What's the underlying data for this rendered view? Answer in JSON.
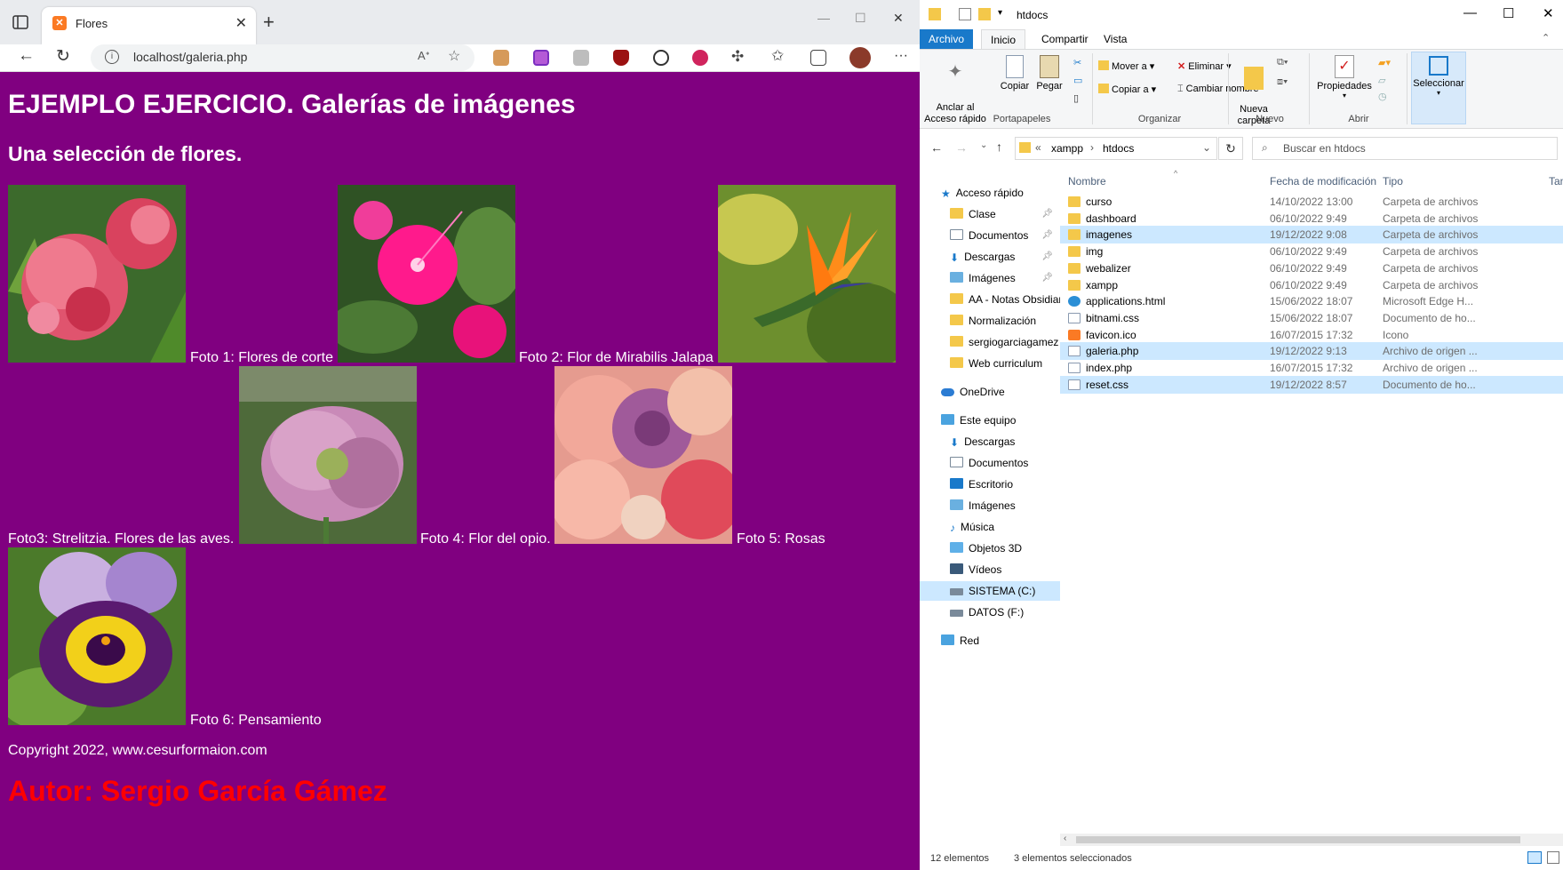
{
  "browser": {
    "tab_title": "Flores",
    "url": "localhost/galeria.php"
  },
  "page": {
    "heading": "EJEMPLO EJERCICIO. Galerías de imágenes",
    "subheading": "Una selección de flores.",
    "captions": [
      "Foto 1: Flores de corte",
      "Foto 2: Flor de Mirabilis Jalapa",
      "Foto3: Strelitzia. Flores de las aves.",
      "Foto 4: Flor del opio.",
      "Foto 5: Rosas",
      "Foto 6: Pensamiento"
    ],
    "copyright": "Copyright 2022, www.cesurformaion.com",
    "author": "Autor: Sergio García Gámez",
    "colors": {
      "background": "#800080",
      "author": "#ff0000"
    }
  },
  "explorer": {
    "title": "htdocs",
    "ribbon_tabs": [
      "Archivo",
      "Inicio",
      "Compartir",
      "Vista"
    ],
    "ribbon": {
      "pin": "Anclar al\nAcceso rápido",
      "copy": "Copiar",
      "paste": "Pegar",
      "move": "Mover a",
      "copy_to": "Copiar a",
      "delete": "Eliminar",
      "rename": "Cambiar nombre",
      "new_folder": "Nueva\ncarpeta",
      "properties": "Propiedades",
      "select": "Seleccionar",
      "groups": [
        "Portapapeles",
        "Organizar",
        "Nuevo",
        "Abrir"
      ]
    },
    "breadcrumb": [
      "xampp",
      "htdocs"
    ],
    "search_placeholder": "Buscar en htdocs",
    "nav": [
      {
        "label": "Acceso rápido",
        "pinned": false
      },
      {
        "label": "Clase",
        "pinned": true
      },
      {
        "label": "Documentos",
        "pinned": true
      },
      {
        "label": "Descargas",
        "pinned": true
      },
      {
        "label": "Imágenes",
        "pinned": true
      },
      {
        "label": "AA - Notas Obsidian",
        "pinned": false
      },
      {
        "label": "Normalización",
        "pinned": false
      },
      {
        "label": "sergiogarciagamez",
        "pinned": false
      },
      {
        "label": "Web curriculum",
        "pinned": false
      },
      {
        "label": "OneDrive",
        "pinned": false
      },
      {
        "label": "Este equipo",
        "pinned": false
      },
      {
        "label": "Descargas",
        "pinned": false
      },
      {
        "label": "Documentos",
        "pinned": false
      },
      {
        "label": "Escritorio",
        "pinned": false
      },
      {
        "label": "Imágenes",
        "pinned": false
      },
      {
        "label": "Música",
        "pinned": false
      },
      {
        "label": "Objetos 3D",
        "pinned": false
      },
      {
        "label": "Vídeos",
        "pinned": false
      },
      {
        "label": "SISTEMA (C:)",
        "pinned": false
      },
      {
        "label": "DATOS (F:)",
        "pinned": false
      },
      {
        "label": "Red",
        "pinned": false
      }
    ],
    "columns": [
      "Nombre",
      "Fecha de modificación",
      "Tipo",
      "Tam"
    ],
    "files": [
      {
        "name": "curso",
        "date": "14/10/2022 13:00",
        "type": "Carpeta de archivos",
        "selected": false
      },
      {
        "name": "dashboard",
        "date": "06/10/2022 9:49",
        "type": "Carpeta de archivos",
        "selected": false
      },
      {
        "name": "imagenes",
        "date": "19/12/2022 9:08",
        "type": "Carpeta de archivos",
        "selected": true
      },
      {
        "name": "img",
        "date": "06/10/2022 9:49",
        "type": "Carpeta de archivos",
        "selected": false
      },
      {
        "name": "webalizer",
        "date": "06/10/2022 9:49",
        "type": "Carpeta de archivos",
        "selected": false
      },
      {
        "name": "xampp",
        "date": "06/10/2022 9:49",
        "type": "Carpeta de archivos",
        "selected": false
      },
      {
        "name": "applications.html",
        "date": "15/06/2022 18:07",
        "type": "Microsoft Edge H...",
        "selected": false
      },
      {
        "name": "bitnami.css",
        "date": "15/06/2022 18:07",
        "type": "Documento de ho...",
        "selected": false
      },
      {
        "name": "favicon.ico",
        "date": "16/07/2015 17:32",
        "type": "Icono",
        "selected": false
      },
      {
        "name": "galeria.php",
        "date": "19/12/2022 9:13",
        "type": "Archivo de origen ...",
        "selected": true
      },
      {
        "name": "index.php",
        "date": "16/07/2015 17:32",
        "type": "Archivo de origen ...",
        "selected": false
      },
      {
        "name": "reset.css",
        "date": "19/12/2022 8:57",
        "type": "Documento de ho...",
        "selected": true
      }
    ],
    "status_count": "12 elementos",
    "status_selected": "3 elementos seleccionados"
  }
}
